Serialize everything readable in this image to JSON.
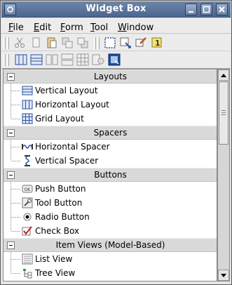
{
  "window": {
    "title": "Widget Box"
  },
  "menubar": {
    "items": [
      {
        "mnemonic": "F",
        "rest": "ile"
      },
      {
        "mnemonic": "E",
        "rest": "dit"
      },
      {
        "mnemonic": "F",
        "rest": "orm"
      },
      {
        "mnemonic": "T",
        "rest": "ool"
      },
      {
        "mnemonic": "W",
        "rest": "indow"
      }
    ]
  },
  "toolbar1": {
    "icons": [
      "cut-icon",
      "copy-icon",
      "paste-icon",
      "bring-front-icon",
      "send-back-icon",
      "edit-widgets-icon",
      "edit-signals-icon",
      "edit-buddies-icon",
      "edit-tab-order-icon"
    ]
  },
  "toolbar2": {
    "icons": [
      "layout-horizontal-icon",
      "layout-vertical-icon",
      "layout-horizontal-splitter-icon",
      "layout-vertical-splitter-icon",
      "layout-grid-icon",
      "break-layout-icon",
      "adjust-size-icon"
    ]
  },
  "tree": {
    "categories": [
      {
        "label": "Layouts",
        "items": [
          "Vertical Layout",
          "Horizontal Layout",
          "Grid Layout"
        ]
      },
      {
        "label": "Spacers",
        "items": [
          "Horizontal Spacer",
          "Vertical Spacer"
        ]
      },
      {
        "label": "Buttons",
        "items": [
          "Push Button",
          "Tool Button",
          "Radio Button",
          "Check Box"
        ]
      },
      {
        "label": "Item Views (Model-Based)",
        "items": [
          "List View",
          "Tree View"
        ]
      }
    ]
  }
}
